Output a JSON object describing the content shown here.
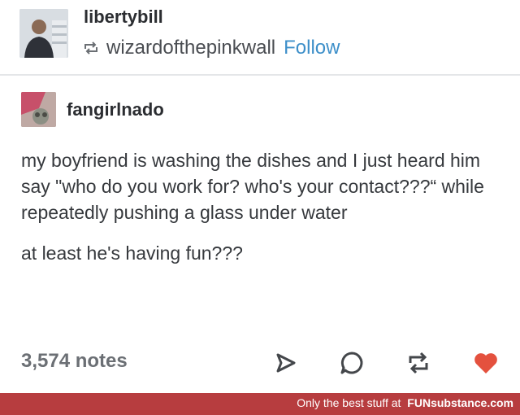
{
  "post": {
    "username": "libertybill",
    "reblogged_from": "wizardofthepinkwall",
    "follow_label": "Follow",
    "reblog_username": "fangirlnado",
    "paragraphs": [
      "my boyfriend is washing the dishes and I just heard him say \"who do you work for? who's your contact???“ while repeatedly pushing a glass under water",
      "at least he's having fun???"
    ],
    "notes": "3,574 notes"
  },
  "colors": {
    "follow": "#3d8fc9",
    "heart": "#e4513e",
    "footer_bg": "#b73d3f"
  },
  "icons": {
    "reblog_small": "reblog-icon",
    "share": "share-icon",
    "reply": "reply-icon",
    "reblog": "reblog-icon",
    "like": "heart-icon"
  },
  "footer": {
    "tagline": "Only the best stuff at",
    "brand": "FUNsubstance.com"
  }
}
